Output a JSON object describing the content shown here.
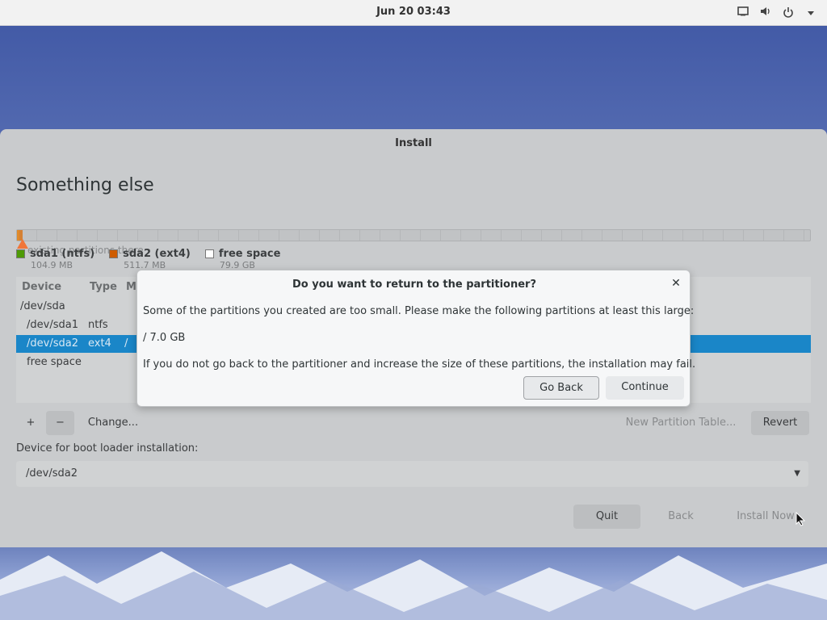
{
  "topbar": {
    "clock": "Jun 20  03:43",
    "icons": [
      "screen-icon",
      "volume-icon",
      "power-icon",
      "chevron-down-icon"
    ]
  },
  "window": {
    "title": "Install",
    "heading": "Something else",
    "existing_text": "existing partitions there",
    "legend": [
      {
        "label": "sda1 (ntfs)",
        "size": "104.9 MB",
        "color": "#4e9a06"
      },
      {
        "label": "sda2 (ext4)",
        "size": "511.7 MB",
        "color": "#ce5c00"
      },
      {
        "label": "free space",
        "size": "79.9 GB",
        "color": "#ffffff"
      }
    ],
    "table": {
      "headers": [
        "Device",
        "Type",
        "M"
      ],
      "rows": [
        {
          "device": "/dev/sda",
          "type": "",
          "mount": ""
        },
        {
          "device": "/dev/sda1",
          "type": "ntfs",
          "mount": ""
        },
        {
          "device": "/dev/sda2",
          "type": "ext4",
          "mount": "/"
        },
        {
          "device": "free space",
          "type": "",
          "mount": ""
        }
      ]
    },
    "toolbar": {
      "add": "+",
      "remove": "−",
      "change": "Change...",
      "new_table": "New Partition Table...",
      "revert": "Revert"
    },
    "boot_label": "Device for boot loader installation:",
    "boot_value": "/dev/sda2",
    "nav": {
      "quit": "Quit",
      "back": "Back",
      "install": "Install Now"
    }
  },
  "dialog": {
    "title": "Do you want to return to the partitioner?",
    "line1": "Some of the partitions you created are too small.  Please make the following partitions at least this large:",
    "line2": "/ 7.0 GB",
    "line3": "If you do not go back to the partitioner and increase the size of these partitions, the installation may fail.",
    "go_back": "Go Back",
    "continue": "Continue"
  }
}
